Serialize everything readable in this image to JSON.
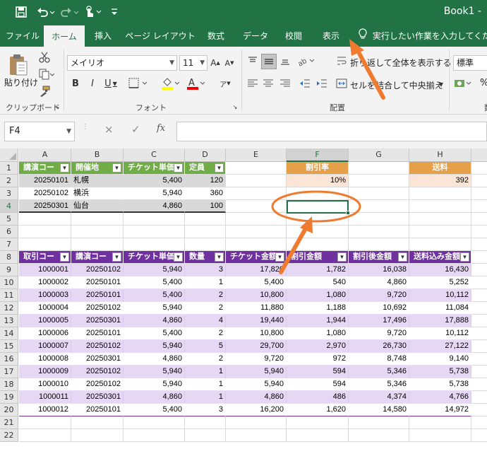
{
  "titlebar": {
    "title": "Book1  -",
    "save_icon": "save-icon",
    "undo_icon": "undo-icon",
    "redo_icon": "redo-icon",
    "touch_icon": "touch-mode-icon",
    "customize_icon": "customize-quick-access-icon"
  },
  "tabs": {
    "items": [
      {
        "label": "ファイル"
      },
      {
        "label": "ホーム",
        "active": true
      },
      {
        "label": "挿入"
      },
      {
        "label": "ページ レイアウト"
      },
      {
        "label": "数式"
      },
      {
        "label": "データ"
      },
      {
        "label": "校閲"
      },
      {
        "label": "表示"
      }
    ],
    "tell_me": "実行したい作業を入力してください"
  },
  "ribbon": {
    "clipboard": {
      "paste_label": "貼り付け",
      "group_label": "クリップボード"
    },
    "font": {
      "font_name": "メイリオ",
      "font_size": "11",
      "group_label": "フォント"
    },
    "alignment": {
      "wrap_label": "折り返して全体を表示する",
      "merge_label": "セルを結合して中央揃え",
      "group_label": "配置"
    },
    "number": {
      "format": "標準",
      "percent": "%"
    }
  },
  "formula_bar": {
    "name_box": "F4",
    "cancel": "×",
    "enter": "✓",
    "fx": "fx",
    "value": ""
  },
  "sheet": {
    "columns": [
      "A",
      "B",
      "C",
      "D",
      "E",
      "F",
      "G",
      "H"
    ],
    "rows": [
      "1",
      "2",
      "3",
      "4",
      "5",
      "6",
      "7",
      "8",
      "9",
      "10",
      "11",
      "12",
      "13",
      "14",
      "15",
      "16",
      "17",
      "18",
      "19",
      "20",
      "21",
      "22"
    ],
    "top_table": {
      "headers": [
        "講演コー",
        "開催地",
        "チケット単価",
        "定員"
      ],
      "rows": [
        [
          "20250101",
          "札幌",
          "5,400",
          "120"
        ],
        [
          "20250102",
          "横浜",
          "5,940",
          "360"
        ],
        [
          "20250301",
          "仙台",
          "4,860",
          "100"
        ]
      ]
    },
    "discount": {
      "label": "割引率",
      "value": "10%"
    },
    "shipping": {
      "label": "送料",
      "value": "392"
    },
    "main_table": {
      "headers": [
        "取引コー",
        "講演コー",
        "チケット単価",
        "数量",
        "チケット金額",
        "割引金額",
        "割引後金額",
        "送料込み金額"
      ],
      "rows": [
        [
          "1000001",
          "20250102",
          "5,940",
          "3",
          "17,820",
          "1,782",
          "16,038",
          "16,430"
        ],
        [
          "1000002",
          "20250101",
          "5,400",
          "1",
          "5,400",
          "540",
          "4,860",
          "5,252"
        ],
        [
          "1000003",
          "20250101",
          "5,400",
          "2",
          "10,800",
          "1,080",
          "9,720",
          "10,112"
        ],
        [
          "1000004",
          "20250102",
          "5,940",
          "2",
          "11,880",
          "1,188",
          "10,692",
          "11,084"
        ],
        [
          "1000005",
          "20250301",
          "4,860",
          "4",
          "19,440",
          "1,944",
          "17,496",
          "17,888"
        ],
        [
          "1000006",
          "20250101",
          "5,400",
          "2",
          "10,800",
          "1,080",
          "9,720",
          "10,112"
        ],
        [
          "1000007",
          "20250102",
          "5,940",
          "5",
          "29,700",
          "2,970",
          "26,730",
          "27,122"
        ],
        [
          "1000008",
          "20250301",
          "4,860",
          "2",
          "9,720",
          "972",
          "8,748",
          "9,140"
        ],
        [
          "1000009",
          "20250102",
          "5,940",
          "1",
          "5,940",
          "594",
          "5,346",
          "5,738"
        ],
        [
          "1000010",
          "20250102",
          "5,940",
          "1",
          "5,940",
          "594",
          "5,346",
          "5,738"
        ],
        [
          "1000011",
          "20250301",
          "4,860",
          "1",
          "4,860",
          "486",
          "4,374",
          "4,766"
        ],
        [
          "1000012",
          "20250101",
          "5,400",
          "3",
          "16,200",
          "1,620",
          "14,580",
          "14,972"
        ]
      ]
    }
  },
  "colors": {
    "excel_green": "#217346",
    "top_header_green": "#70ad47",
    "top_band_gray": "#d9d9d9",
    "orange_header": "#e6a04a",
    "orange_light": "#fbe5d6",
    "purple_header": "#7030a0",
    "purple_band": "#e6d8f4",
    "annotation_orange": "#ee7b30"
  }
}
